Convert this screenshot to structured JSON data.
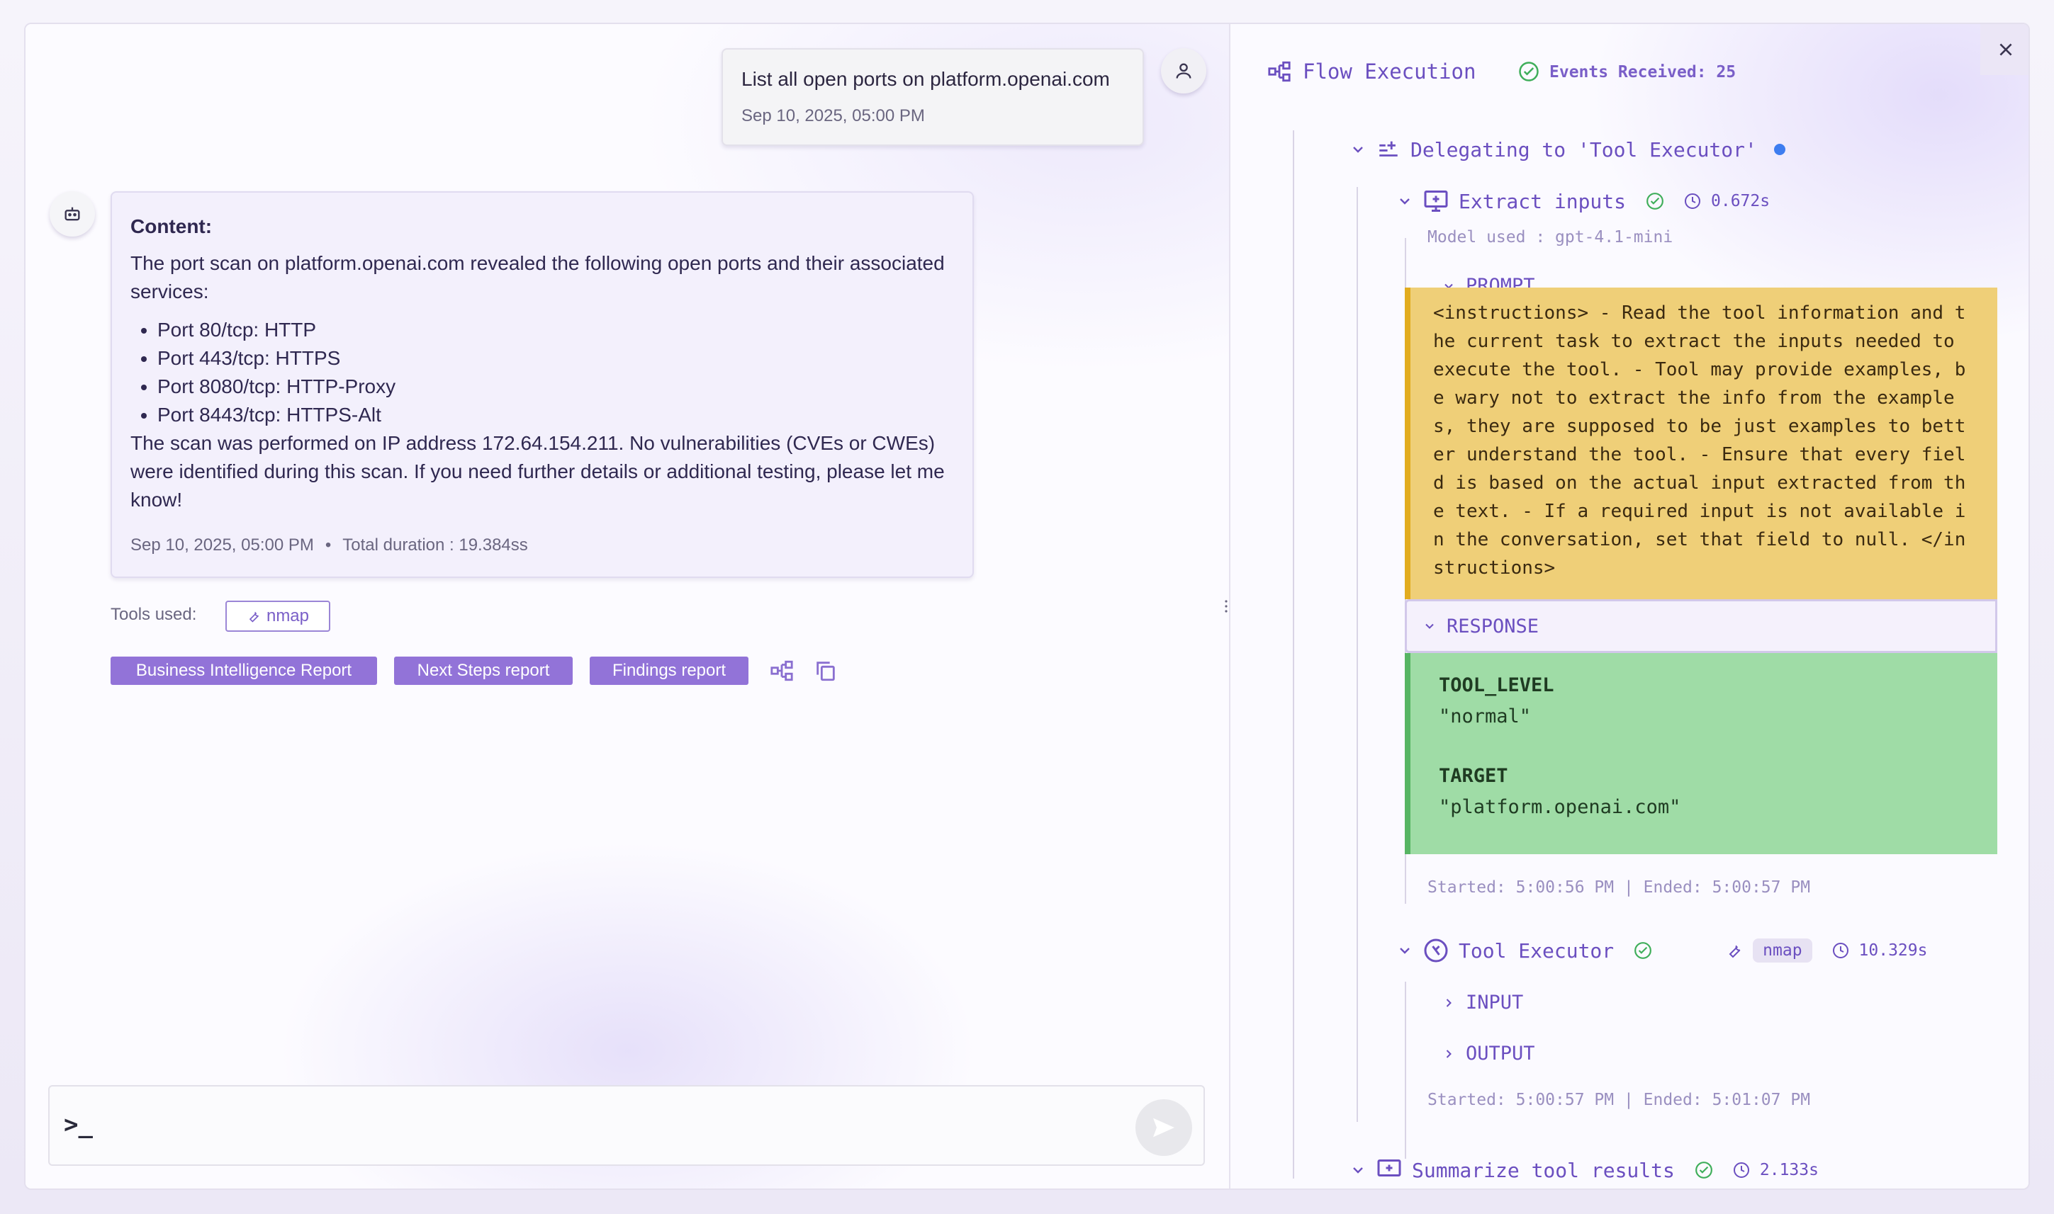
{
  "chat": {
    "user_message": "List all open ports on platform.openai.com",
    "user_timestamp": "Sep 10, 2025, 05:00 PM",
    "assistant": {
      "heading": "Content:",
      "intro": "The port scan on platform.openai.com revealed the following open ports and their associated services:",
      "ports": [
        "Port 80/tcp: HTTP",
        "Port 443/tcp: HTTPS",
        "Port 8080/tcp: HTTP-Proxy",
        "Port 8443/tcp: HTTPS-Alt"
      ],
      "outro": "The scan was performed on IP address 172.64.154.211. No vulnerabilities (CVEs or CWEs) were identified during this scan. If you need further details or additional testing, please let me know!",
      "timestamp": "Sep 10, 2025, 05:00 PM",
      "separator": "•",
      "duration": "Total duration : 19.384ss"
    },
    "tools_label": "Tools used:",
    "tool_chip": "nmap",
    "reports": [
      "Business Intelligence Report",
      "Next Steps report",
      "Findings report"
    ],
    "input_prompt": ">_"
  },
  "flow": {
    "title": "Flow Execution",
    "events": "Events Received: 25",
    "delegating": "Delegating to 'Tool Executor'",
    "extract": {
      "label": "Extract inputs",
      "duration": "0.672s",
      "model": "Model used : gpt-4.1-mini",
      "prompt_label": "PROMPT",
      "prompt_text": "<instructions> - Read the tool information and the current task to extract the inputs needed to execute the tool. - Tool may provide examples, be wary not to extract the info from the examples, they are supposed to be just examples to better understand the tool. - Ensure that every field is based on the actual input extracted from the text. - If a required input is not available in the conversation, set that field to null. </instructions>",
      "response_label": "RESPONSE",
      "response": [
        {
          "key": "TOOL_LEVEL",
          "value": "\"normal\""
        },
        {
          "key": "TARGET",
          "value": "\"platform.openai.com\""
        }
      ],
      "times": "Started: 5:00:56 PM | Ended: 5:00:57 PM"
    },
    "tool_executor": {
      "label": "Tool Executor",
      "tool": "nmap",
      "duration": "10.329s",
      "input_label": "INPUT",
      "output_label": "OUTPUT",
      "times": "Started: 5:00:57 PM | Ended: 5:01:07 PM"
    },
    "summarize": {
      "label": "Summarize tool results",
      "duration": "2.133s"
    }
  },
  "colors": {
    "accent": "#6b4fc0",
    "report_button": "#9273d8",
    "prompt_bg": "#efcf78",
    "response_bg": "#9fdca6",
    "success": "#3fae5a"
  }
}
